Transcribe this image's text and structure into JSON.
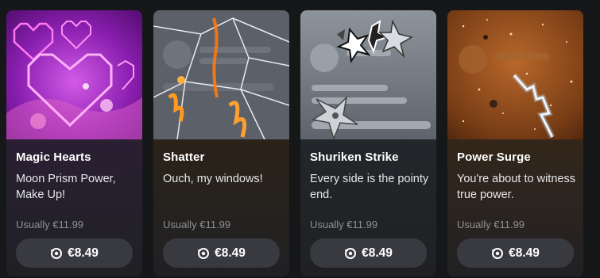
{
  "products": [
    {
      "title": "Magic Hearts",
      "description": "Moon Prism Power, Make Up!",
      "regular_price": "Usually €11.99",
      "price": "€8.49",
      "art_icon": "pink-hearts"
    },
    {
      "title": "Shatter",
      "description": "Ouch, my windows!",
      "regular_price": "Usually €11.99",
      "price": "€8.49",
      "art_icon": "broken-glass-flames"
    },
    {
      "title": "Shuriken Strike",
      "description": "Every side is the pointy end.",
      "regular_price": "Usually €11.99",
      "price": "€8.49",
      "art_icon": "shuriken"
    },
    {
      "title": "Power Surge",
      "description": "You're about to witness true power.",
      "regular_price": "Usually €11.99",
      "price": "€8.49",
      "art_icon": "lightning"
    }
  ],
  "button_icon": "orb-icon"
}
